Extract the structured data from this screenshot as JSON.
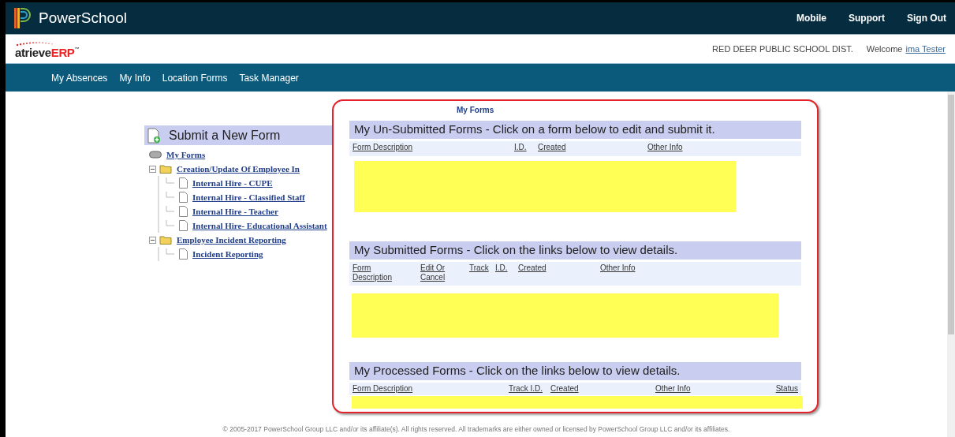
{
  "top_bar": {
    "brand": "PowerSchool",
    "links": [
      "Mobile",
      "Support",
      "Sign Out"
    ]
  },
  "header": {
    "logo": {
      "part_1": "atrieve",
      "part_2": "ERP",
      "mark": "™"
    },
    "district": "RED DEER PUBLIC SCHOOL DIST.",
    "welcome": "Welcome",
    "user": "ima Tester"
  },
  "nav": {
    "items": [
      "My Absences",
      "My Info",
      "Location Forms",
      "Task Manager"
    ]
  },
  "sidebar": {
    "title": "Submit a New Form",
    "tree": {
      "label": "My Forms",
      "children": [
        {
          "label": "Creation/Update Of Employee In",
          "expanded": true,
          "children": [
            {
              "label": "Internal Hire - CUPE"
            },
            {
              "label": "Internal Hire - Classified Staff"
            },
            {
              "label": "Internal Hire - Teacher"
            },
            {
              "label": "Internal Hire- Educational Assistant"
            }
          ]
        },
        {
          "label": "Employee Incident Reporting",
          "expanded": true,
          "children": [
            {
              "label": "Incident Reporting"
            }
          ]
        }
      ]
    }
  },
  "main": {
    "title": "My Forms",
    "sections": [
      {
        "title": "My Un-Submitted Forms - Click on a form below to edit and submit it.",
        "columns": [
          "Form Description",
          "I.D.",
          "Created",
          "Other Info"
        ]
      },
      {
        "title": "My Submitted Forms - Click on the links below to view details.",
        "columns": [
          "Form Description",
          "Edit Or Cancel",
          "Track",
          "I.D.",
          "Created",
          "Other Info"
        ]
      },
      {
        "title": "My Processed Forms - Click on the links below to view details.",
        "columns": [
          "Form Description",
          "Track I.D.",
          "Created",
          "Other Info",
          "Status"
        ]
      }
    ]
  },
  "footer": "© 2005-2017 PowerSchool Group LLC and/or its affiliate(s). All rights reserved. All trademarks are either owned or licensed by PowerSchool Group LLC and/or its affiliates."
}
